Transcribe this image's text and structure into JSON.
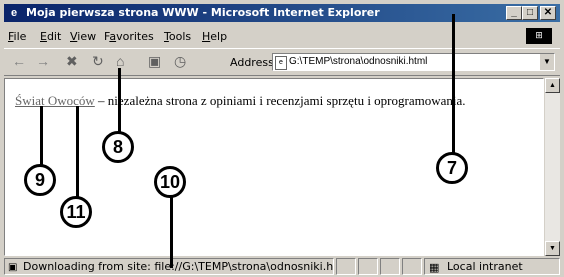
{
  "window": {
    "title": "Moja pierwsza strona WWW - Microsoft Internet Explorer",
    "buttons": {
      "minimize": "_",
      "maximize": "□",
      "close": "✕"
    }
  },
  "menu": {
    "items": [
      {
        "pre": "",
        "u": "F",
        "post": "ile"
      },
      {
        "pre": "",
        "u": "E",
        "post": "dit"
      },
      {
        "pre": "",
        "u": "V",
        "post": "iew"
      },
      {
        "pre": "F",
        "u": "a",
        "post": "vorites"
      },
      {
        "pre": "",
        "u": "T",
        "post": "ools"
      },
      {
        "pre": "",
        "u": "H",
        "post": "elp"
      }
    ]
  },
  "toolbar": {
    "back_icon": "←",
    "forward_icon": "→",
    "stop_icon": "✖",
    "refresh_icon": "↻",
    "home_icon": "⌂",
    "search_icon": "▣",
    "history_icon": "◷",
    "address_label": "Address",
    "address_value": "G:\\TEMP\\strona\\odnosniki.html"
  },
  "content": {
    "link_text": "Świat Owoców",
    "body_text": " – niezależna strona z opiniami i recenzjami sprzętu i oprogramowania."
  },
  "status": {
    "text": "Downloading from site: file://G:\\TEMP\\strona\\odnosniki.html",
    "zone": "Local intranet"
  },
  "callouts": [
    "7",
    "8",
    "9",
    "10",
    "11"
  ],
  "colors": {
    "title_start": "#0a246a",
    "title_end": "#3a6ea5",
    "chrome": "#d4d0c8"
  }
}
